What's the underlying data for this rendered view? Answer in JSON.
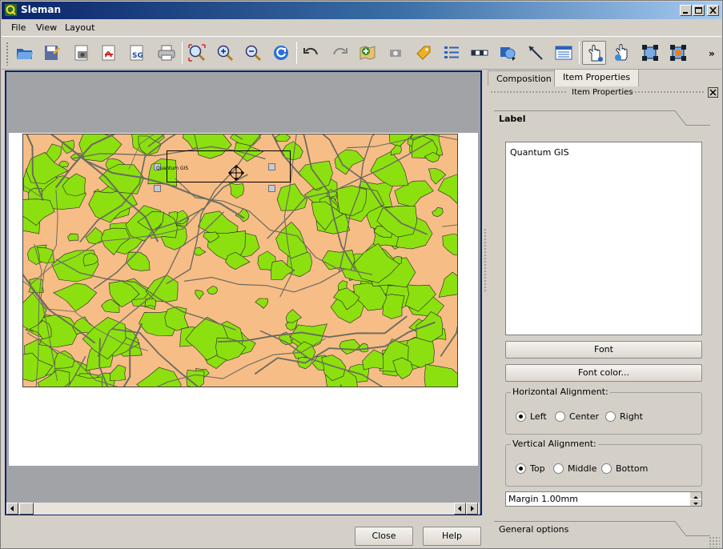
{
  "window": {
    "title": "Sleman",
    "app_icon": "qgis-q-icon"
  },
  "menubar": {
    "items": [
      "File",
      "View",
      "Layout"
    ]
  },
  "toolbar": {
    "icons": [
      "open-template-icon",
      "save-template-icon",
      "export-image-icon",
      "export-pdf-icon",
      "export-svg-icon",
      "print-icon",
      "zoom-full-icon",
      "zoom-in-icon",
      "zoom-out-icon",
      "refresh-icon",
      "undo-icon",
      "redo-icon",
      "add-map-icon",
      "add-image-icon",
      "add-label-icon",
      "add-legend-icon",
      "add-scalebar-icon",
      "add-shape-icon",
      "add-arrow-icon",
      "add-table-icon",
      "select-move-item-icon",
      "move-content-icon",
      "group-icon",
      "ungroup-icon"
    ],
    "overflow": "»"
  },
  "canvas": {
    "label_text": "Quantum GIS",
    "map_colors": {
      "bg": "#f7bd86",
      "green": "#8ce010",
      "roads": "#6b6b5e"
    }
  },
  "panel": {
    "tabs": [
      "Composition",
      "Item Properties"
    ],
    "active_tab": "Item Properties",
    "dock_title": "Item Properties",
    "section_label": "Label",
    "label_text": "Quantum GIS",
    "font_button": "Font",
    "font_color_button": "Font color...",
    "horizontal": {
      "title": "Horizontal Alignment:",
      "options": [
        "Left",
        "Center",
        "Right"
      ],
      "selected": "Left"
    },
    "vertical": {
      "title": "Vertical Alignment:",
      "options": [
        "Top",
        "Middle",
        "Bottom"
      ],
      "selected": "Top"
    },
    "margin": "Margin 1.00mm",
    "general_options": "General options"
  },
  "buttons": {
    "close": "Close",
    "help": "Help"
  }
}
